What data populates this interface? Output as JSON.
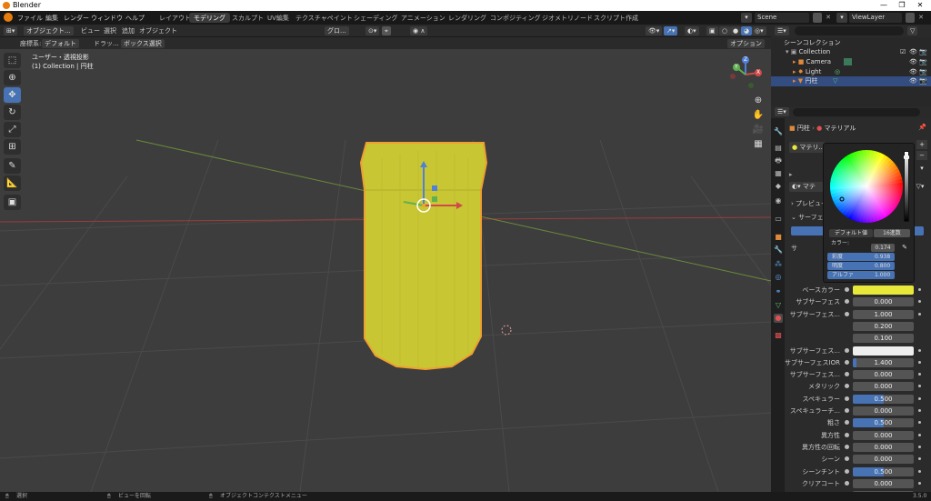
{
  "window": {
    "title": "Blender",
    "controls": [
      "—",
      "❐",
      "✕"
    ]
  },
  "menu": [
    "ファイル",
    "編集",
    "レンダー",
    "ウィンドウ",
    "ヘルプ"
  ],
  "workspaces": [
    "レイアウト",
    "モデリング",
    "スカルプト",
    "UV編集",
    "テクスチャペイント",
    "シェーディング",
    "アニメーション",
    "レンダリング",
    "コンポジティング",
    "ジオメトリノード",
    "スクリプト作成"
  ],
  "active_workspace": "モデリング",
  "scene": {
    "scene_label": "Scene",
    "viewlayer_label": "ViewLayer"
  },
  "header": {
    "mode": "オブジェクト...",
    "view": "ビュー",
    "select": "選択",
    "add": "追加",
    "object": "オブジェクト",
    "orientation": "グロ...",
    "options": "オプション"
  },
  "header2": {
    "coord_label": "座標系:",
    "coord_value": "デフォルト",
    "drag_label": "ドラッ...",
    "box_select": "ボックス選択"
  },
  "viewport": {
    "info_line1": "ユーザー・透視投影",
    "info_line2": "(1) Collection | 円柱"
  },
  "gizmo": {
    "x": "X",
    "y": "Y",
    "z": "Z"
  },
  "outliner": {
    "scene_collection": "シーンコレクション",
    "collection": "Collection",
    "items": [
      {
        "name": "Camera",
        "icon": "camera-icon",
        "color": "#e0883a"
      },
      {
        "name": "Light",
        "icon": "light-icon",
        "color": "#e0883a"
      },
      {
        "name": "円柱",
        "icon": "mesh-icon",
        "color": "#e0883a"
      }
    ]
  },
  "properties": {
    "breadcrumb_object": "円柱",
    "breadcrumb_material": "マテリアル",
    "material_slot": "マテリ...",
    "material_name_short": "マテ",
    "preview_label": "プレビュー",
    "surface_label": "サーフェ...",
    "rows": [
      {
        "label": "ベースカラー",
        "value": "",
        "color": "#e8e83a",
        "fill": 0
      },
      {
        "label": "サブサーフェス",
        "value": "0.000",
        "fill": 0
      },
      {
        "label": "サブサーフェス...",
        "value": "1.000",
        "fill": 0
      },
      {
        "label": "",
        "value": "0.200",
        "fill": 0
      },
      {
        "label": "",
        "value": "0.100",
        "fill": 0
      },
      {
        "label": "サブサーフェス...",
        "value": "",
        "color": "#eeeeee",
        "fill": 0
      },
      {
        "label": "サブサーフェスIOR",
        "value": "1.400",
        "fill": 0.06
      },
      {
        "label": "サブサーフェス...",
        "value": "0.000",
        "fill": 0
      },
      {
        "label": "メタリック",
        "value": "0.000",
        "fill": 0
      },
      {
        "label": "スペキュラー",
        "value": "0.500",
        "fill": 0.5
      },
      {
        "label": "スペキュラーチ...",
        "value": "0.000",
        "fill": 0
      },
      {
        "label": "粗さ",
        "value": "0.500",
        "fill": 0.5
      },
      {
        "label": "異方性",
        "value": "0.000",
        "fill": 0
      },
      {
        "label": "異方性の回転",
        "value": "0.000",
        "fill": 0
      },
      {
        "label": "シーン",
        "value": "0.000",
        "fill": 0
      },
      {
        "label": "シーンチント",
        "value": "0.500",
        "fill": 0.5
      },
      {
        "label": "クリアコート",
        "value": "0.000",
        "fill": 0
      },
      {
        "label": "クリアコート...",
        "value": "0.030",
        "fill": 0
      }
    ]
  },
  "color_popup": {
    "tab_default": "デフォルト値",
    "tab_hex": "16進数",
    "color_label": "カラー:",
    "hue_value": "0.174",
    "saturation_label": "彩度",
    "saturation_value": "0.938",
    "value_label": "明度",
    "value_value": "0.800",
    "alpha_label": "アルファ",
    "alpha_value": "1.000"
  },
  "status": {
    "select": "選択",
    "rotate": "ビューを回転",
    "context": "オブジェクトコンテクストメニュー",
    "version": "3.5.0"
  }
}
